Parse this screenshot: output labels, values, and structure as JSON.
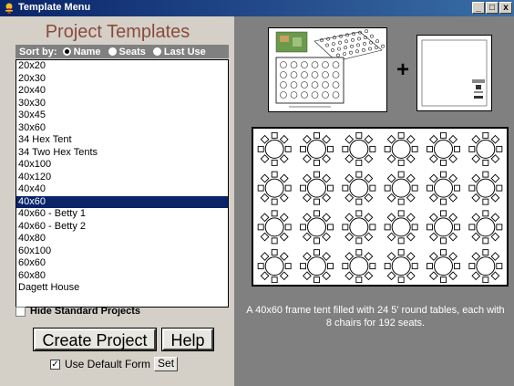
{
  "window": {
    "title": "Template Menu",
    "controls": [
      "_",
      "□",
      "x"
    ]
  },
  "left": {
    "heading": "Project Templates",
    "sort": {
      "label": "Sort by:",
      "options": [
        {
          "label": "Name",
          "selected": true
        },
        {
          "label": "Seats",
          "selected": false
        },
        {
          "label": "Last Use",
          "selected": false
        }
      ]
    },
    "templates": [
      "20x20",
      "20x30",
      "20x40",
      "30x30",
      "30x45",
      "30x60",
      "34 Hex Tent",
      "34 Two Hex Tents",
      "40x100",
      "40x120",
      "40x40",
      "40x60",
      "40x60 - Betty 1",
      "40x60 - Betty 2",
      "40x80",
      "60x100",
      "60x60",
      "60x80",
      "Dagett House"
    ],
    "selected_template": "40x60",
    "hide_standard_label": "Hide Standard Projects",
    "hide_standard_checked": false,
    "create_button": "Create Project",
    "help_button": "Help",
    "default_form_label": "Use Default Form",
    "default_form_checked": true,
    "set_button": "Set"
  },
  "right": {
    "plus_symbol": "+",
    "description": "A 40x60 frame tent filled with 24 5' round tables, each with 8 chairs for 192 seats.",
    "layout": {
      "rows": 4,
      "cols": 6
    }
  },
  "colors": {
    "title_bar": "#0a246a",
    "heading": "#8b4a3c",
    "selection": "#0a246a",
    "panel_gray": "#808080"
  }
}
